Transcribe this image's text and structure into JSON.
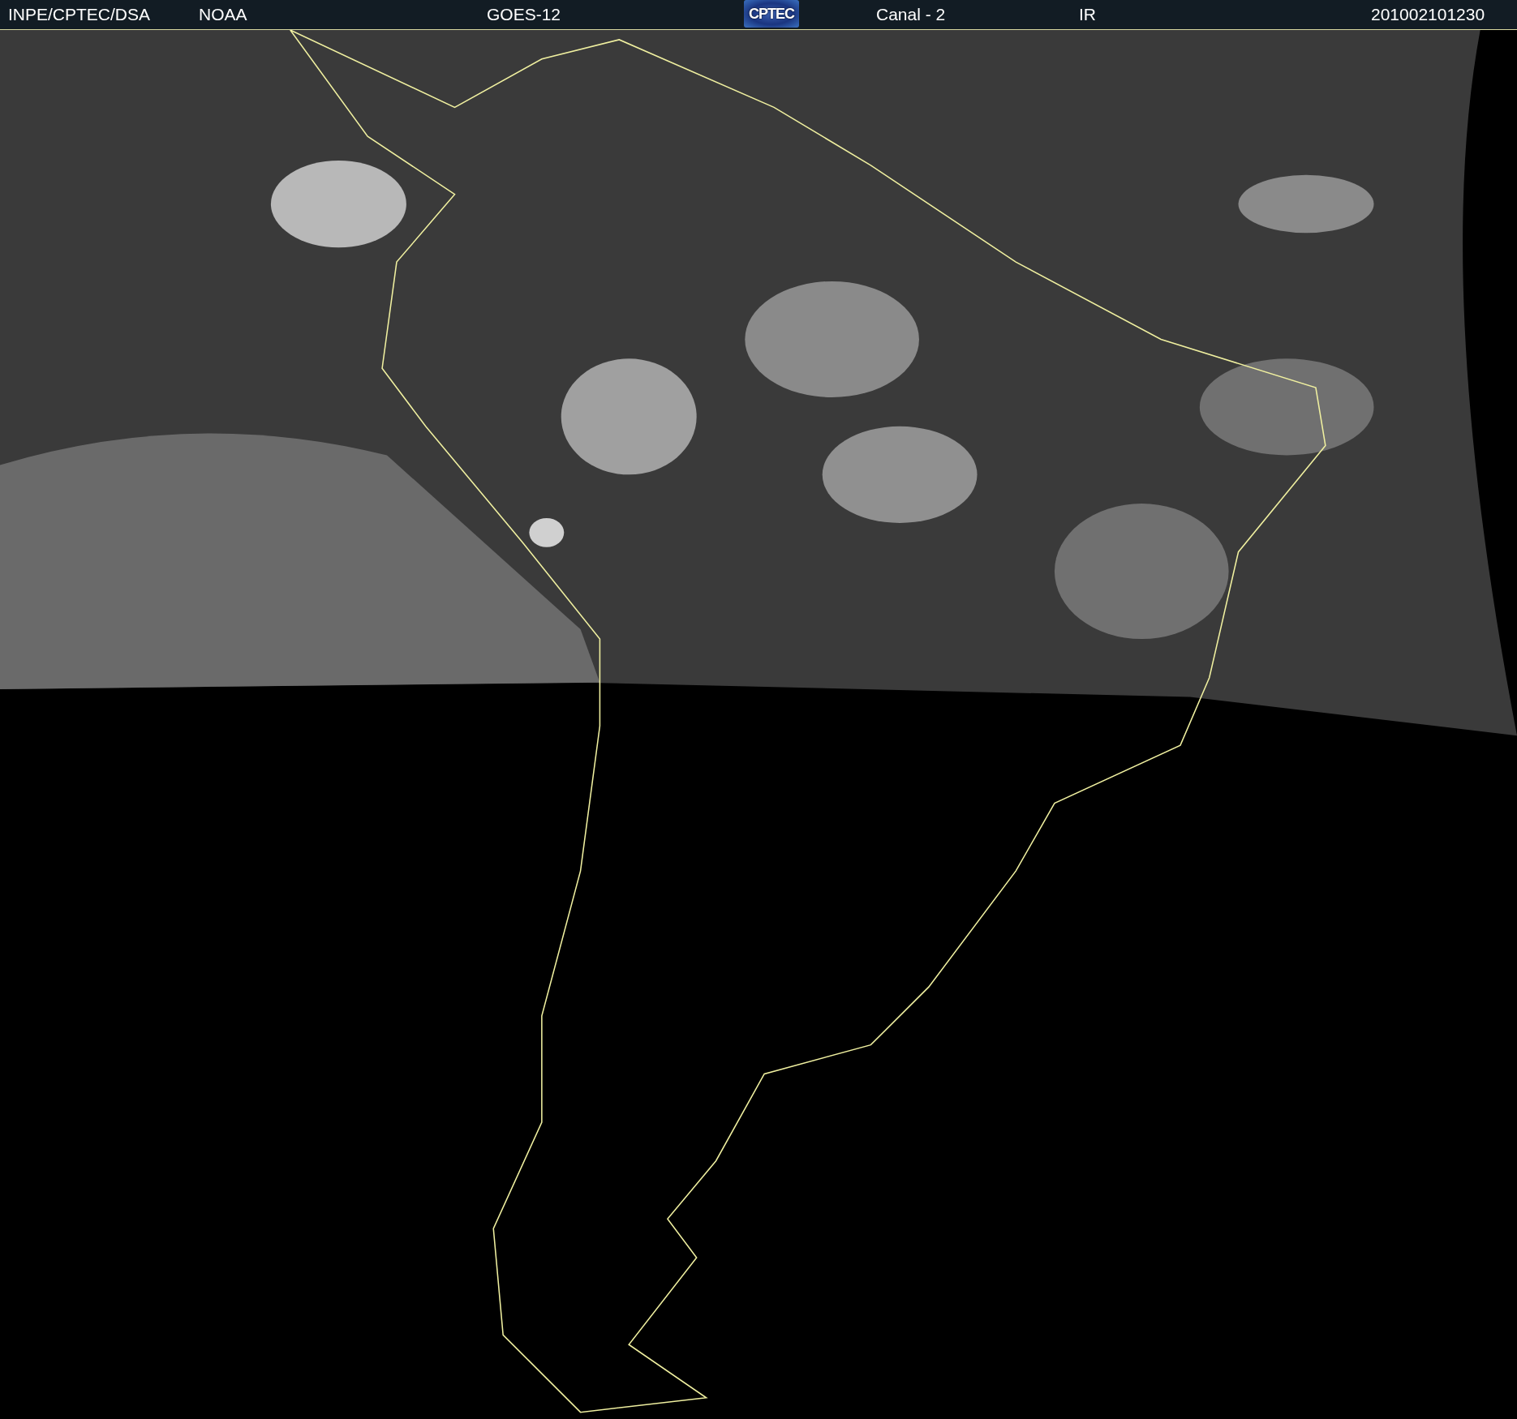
{
  "header": {
    "items": [
      {
        "kind": "text",
        "text": "INPE/CPTEC/DSA"
      },
      {
        "kind": "text",
        "text": "NOAA"
      },
      {
        "kind": "text",
        "text": "GOES-12"
      },
      {
        "kind": "logo",
        "text": "CPTEC"
      },
      {
        "kind": "text",
        "text": "Canal - 2"
      },
      {
        "kind": "text",
        "text": "IR"
      },
      {
        "kind": "text",
        "text": "201002101230"
      }
    ]
  }
}
